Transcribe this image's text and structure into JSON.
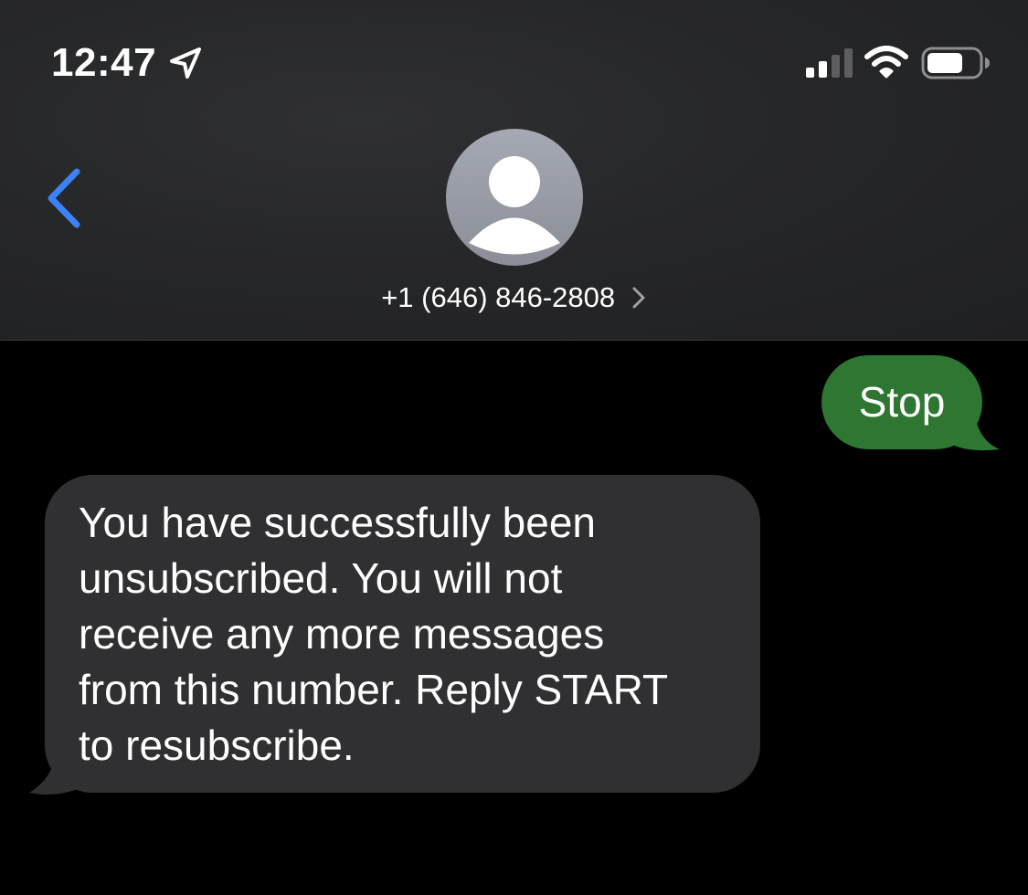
{
  "status_bar": {
    "time": "12:47",
    "location_icon": "location-arrow-icon",
    "signal_icon": "cellular-signal-icon",
    "wifi_icon": "wifi-icon",
    "battery_icon": "battery-icon"
  },
  "nav": {
    "back_icon": "chevron-left-icon",
    "contact": {
      "name": "+1 (646) 846-2808",
      "avatar_icon": "person-silhouette-icon",
      "chevron_icon": "chevron-right-icon"
    }
  },
  "messages": [
    {
      "direction": "outgoing",
      "text": "Stop"
    },
    {
      "direction": "incoming",
      "text": "You have successfully been\nunsubscribed. You will not\nreceive any more messages\nfrom this number. Reply START\nto resubscribe."
    }
  ],
  "colors": {
    "accent_blue": "#3b82f6",
    "sent_bubble": "#2e7632",
    "received_bubble": "#303033",
    "background": "#000000",
    "header": "#262729"
  }
}
